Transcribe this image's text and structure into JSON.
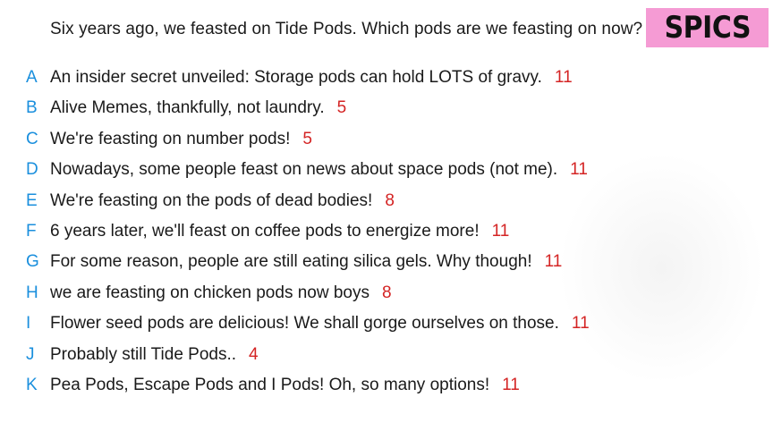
{
  "question": "Six years ago, we feasted on Tide Pods. Which pods are we feasting on now?",
  "logo": "SPICS",
  "colors": {
    "letter": "#1a8fdd",
    "score": "#d42424",
    "logo_bg": "#f59bd4"
  },
  "answers": [
    {
      "letter": "A",
      "text": "An insider secret unveiled: Storage pods can hold LOTS of gravy.",
      "score": "11"
    },
    {
      "letter": "B",
      "text": "Alive Memes, thankfully, not laundry.",
      "score": "5"
    },
    {
      "letter": "C",
      "text": "We're feasting on number pods!",
      "score": "5"
    },
    {
      "letter": "D",
      "text": "Nowadays, some people feast on news about space pods (not me).",
      "score": "11"
    },
    {
      "letter": "E",
      "text": "We're feasting on the pods of dead bodies!",
      "score": "8"
    },
    {
      "letter": "F",
      "text": "6 years later, we'll feast on coffee pods to energize more!",
      "score": "11"
    },
    {
      "letter": "G",
      "text": "For some reason, people are still eating silica gels. Why though!",
      "score": "11"
    },
    {
      "letter": "H",
      "text": "we are feasting on chicken pods now boys",
      "score": "8"
    },
    {
      "letter": "I",
      "text": "Flower seed pods are delicious! We shall gorge ourselves on those.",
      "score": "11"
    },
    {
      "letter": "J",
      "text": "Probably still Tide Pods..",
      "score": "4"
    },
    {
      "letter": "K",
      "text": "Pea Pods, Escape Pods and I Pods! Oh, so many options!",
      "score": "11"
    }
  ]
}
